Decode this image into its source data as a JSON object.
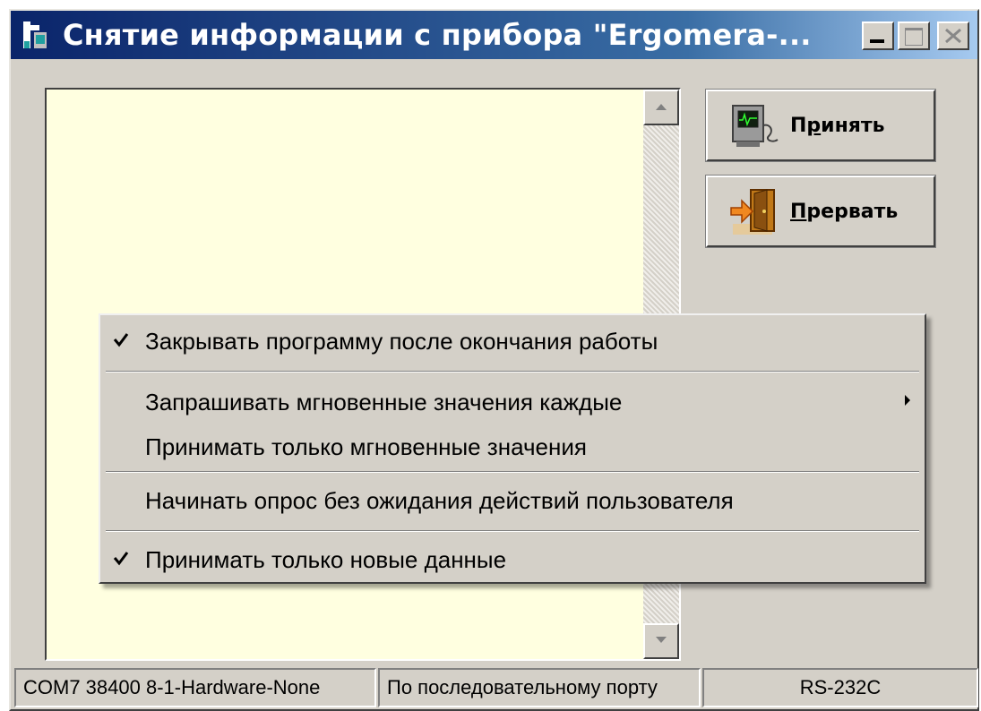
{
  "window": {
    "title": "Снятие информации с прибора \"Ergomera-...",
    "controls": [
      "minimize-icon",
      "maximize-icon",
      "close-icon"
    ]
  },
  "buttons": {
    "accept": {
      "label_pre": "П",
      "label_u": "р",
      "label_post": "инять",
      "icon": "device-monitor-icon"
    },
    "abort": {
      "label_pre": "",
      "label_u": "П",
      "label_post": "рервать",
      "icon": "exit-door-icon"
    }
  },
  "log": {
    "text": ""
  },
  "context_menu": {
    "items": [
      {
        "label": "Закрывать программу после окончания работы",
        "checked": true
      },
      {
        "label": "Запрашивать мгновенные значения каждые",
        "checked": false,
        "submenu": true
      },
      {
        "label": "Принимать только мгновенные значения",
        "checked": false
      },
      {
        "label": "Начинать опрос без ожидания действий пользователя",
        "checked": false
      },
      {
        "label": "Принимать только новые данные",
        "checked": true
      }
    ]
  },
  "statusbar": {
    "port": "COM7 38400 8-1-Hardware-None",
    "mode": "По последовательному порту",
    "interface": "RS-232C"
  },
  "colors": {
    "title_start": "#0a246a",
    "title_end": "#a6caf0",
    "face": "#d4d0c8",
    "log_bg": "#ffffe0"
  }
}
